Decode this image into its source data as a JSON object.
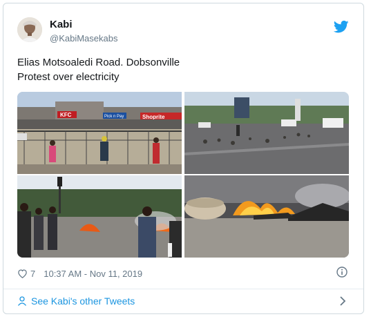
{
  "tweet": {
    "author_name": "Kabi",
    "author_handle": "@KabiMasekabs",
    "text_line1": "Elias Motsoaledi Road. Dobsonville",
    "text_line2": "Protest over electricity",
    "like_count": "7",
    "timestamp": "10:37 AM - Nov 11, 2019"
  },
  "photo1": {
    "sign_kfc": "KFC",
    "sign_picknpay": "Pick n Pay",
    "sign_shoprite": "Shoprite"
  },
  "footer": {
    "link_label": "See Kabi's other Tweets"
  },
  "icons": {
    "brand": "twitter-bird-icon",
    "like": "heart-icon",
    "info": "info-icon",
    "person": "person-icon",
    "chevron": "chevron-right-icon"
  },
  "colors": {
    "twitter_blue": "#1da1f2",
    "link_blue": "#1b95e0",
    "muted_gray": "#657786",
    "border": "#cfd9de"
  }
}
